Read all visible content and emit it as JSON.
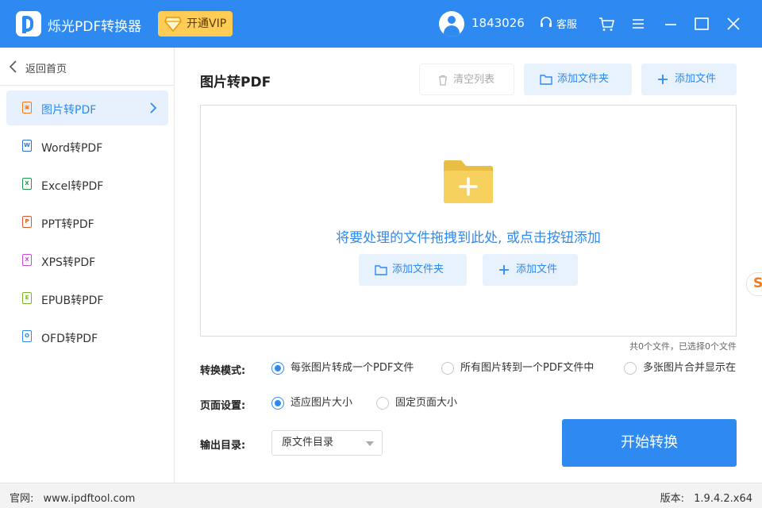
{
  "app": {
    "name": "烁光PDF转换器",
    "vip_label": "开通VIP",
    "user_id": "1843026",
    "support_label": "客服"
  },
  "colors": {
    "accent": "#2e8af0",
    "vip": "#ffcc55",
    "folder": "#f7d15e"
  },
  "sidebar": {
    "back_label": "返回首页",
    "items": [
      {
        "label": "图片转PDF",
        "icon": "image-file-icon",
        "color": "#f07a20"
      },
      {
        "label": "Word转PDF",
        "icon": "word-file-icon",
        "color": "#2e6fd8"
      },
      {
        "label": "Excel转PDF",
        "icon": "excel-file-icon",
        "color": "#1f9a4c"
      },
      {
        "label": "PPT转PDF",
        "icon": "ppt-file-icon",
        "color": "#e25a2c"
      },
      {
        "label": "XPS转PDF",
        "icon": "xps-file-icon",
        "color": "#c84bd8"
      },
      {
        "label": "EPUB转PDF",
        "icon": "epub-file-icon",
        "color": "#7bb62a"
      },
      {
        "label": "OFD转PDF",
        "icon": "ofd-file-icon",
        "color": "#2e8af0"
      }
    ]
  },
  "main": {
    "title": "图片转PDF",
    "clear_label": "清空列表",
    "add_folder_label": "添加文件夹",
    "add_file_label": "添加文件",
    "drop_hint": "将要处理的文件拖拽到此处, 或点击按钮添加",
    "count_text": "共0个文件，已选择0个文件",
    "mode_label": "转换模式:",
    "modes": [
      "每张图片转成一个PDF文件",
      "所有图片转到一个PDF文件中",
      "多张图片合并显示在"
    ],
    "page_label": "页面设置:",
    "page_options": [
      "适应图片大小",
      "固定页面大小"
    ],
    "output_label": "输出目录:",
    "output_value": "原文件目录",
    "start_label": "开始转换"
  },
  "side_tab": {
    "glyph": "S"
  },
  "footer": {
    "site_label": "官网:",
    "site_url": "www.ipdftool.com",
    "version_label": "版本:",
    "version": "1.9.4.2.x64"
  }
}
